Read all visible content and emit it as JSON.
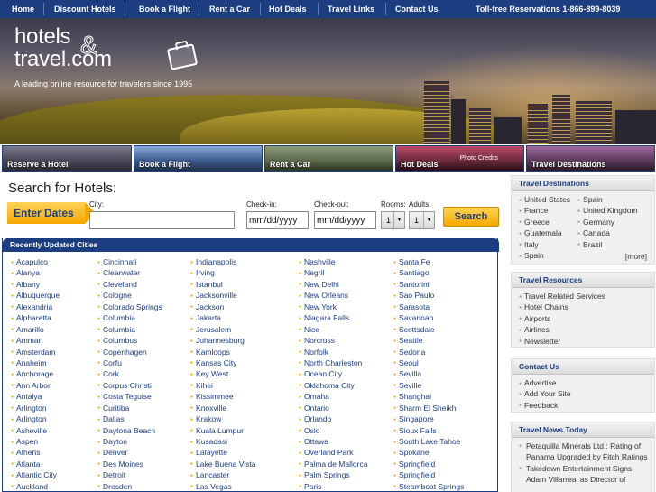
{
  "nav": {
    "items": [
      "Home",
      "Discount Hotels",
      "Book a Flight",
      "Rent a Car",
      "Hot Deals",
      "Travel Links",
      "Contact Us"
    ],
    "phone": "Toll-free Reservations 1-866-899-8039"
  },
  "banner": {
    "logo_line1": "hotels",
    "logo_amp": "&",
    "logo_line2": "travel.com",
    "tagline": "A leading online resource for travelers since 1995"
  },
  "tiles": {
    "items": [
      "Reserve a Hotel",
      "Book a Flight",
      "Rent a Car",
      "Hot Deals",
      "Travel Destinations"
    ],
    "photo_credits": "Photo Credits",
    "colors": [
      "#4a4a5c",
      "#3c5a8c",
      "#5c6a4c",
      "#6a2a3a",
      "#5a3a5a"
    ]
  },
  "search": {
    "title": "Search for Hotels:",
    "enter_dates": "Enter Dates",
    "city_label": "City:",
    "city_value": "",
    "checkin_label": "Check-in:",
    "checkin_value": "mm/dd/yyyy",
    "checkout_label": "Check-out:",
    "checkout_value": "mm/dd/yyyy",
    "rooms_label": "Rooms:",
    "rooms_value": "1",
    "adults_label": "Adults:",
    "adults_value": "1",
    "button": "Search"
  },
  "cities": {
    "header": "Recently Updated Cities",
    "columns": [
      [
        "Acapulco",
        "Alanya",
        "Albany",
        "Albuquerque",
        "Alexandria",
        "Alpharetta",
        "Amarillo",
        "Amman",
        "Amsterdam",
        "Anaheim",
        "Anchorage",
        "Ann Arbor",
        "Antalya",
        "Arlington",
        "Arlington",
        "Asheville",
        "Aspen",
        "Athens",
        "Atlanta",
        "Atlantic City",
        "Auckland"
      ],
      [
        "Cincinnati",
        "Clearwater",
        "Cleveland",
        "Cologne",
        "Colorado Springs",
        "Columbia",
        "Columbia",
        "Columbus",
        "Copenhagen",
        "Corfu",
        "Cork",
        "Corpus Christi",
        "Costa Teguise",
        "Curitiba",
        "Dallas",
        "Daytona Beach",
        "Dayton",
        "Denver",
        "Des Moines",
        "Detroit",
        "Dresden"
      ],
      [
        "Indianapolis",
        "Irving",
        "Istanbul",
        "Jacksonville",
        "Jackson",
        "Jakarta",
        "Jerusalem",
        "Johannesburg",
        "Kamloops",
        "Kansas City",
        "Key West",
        "Kihei",
        "Kissimmee",
        "Knoxville",
        "Krakow",
        "Kuala Lumpur",
        "Kusadasi",
        "Lafayette",
        "Lake Buena Vista",
        "Lancaster",
        "Las Vegas"
      ],
      [
        "Nashville",
        "Negril",
        "New Delhi",
        "New Orleans",
        "New York",
        "Niagara Falls",
        "Nice",
        "Norcross",
        "Norfolk",
        "North Charleston",
        "Ocean City",
        "Oklahoma City",
        "Omaha",
        "Ontario",
        "Orlando",
        "Oslo",
        "Ottawa",
        "Overland Park",
        "Palma de Mallorca",
        "Palm Springs",
        "Paris"
      ],
      [
        "Santa Fe",
        "Santiago",
        "Santorini",
        "Sao Paulo",
        "Sarasota",
        "Savannah",
        "Scottsdale",
        "Seattle",
        "Sedona",
        "Seoul",
        "Sevilla",
        "Seville",
        "Shanghai",
        "Sharm El Sheikh",
        "Singapore",
        "Sioux Falls",
        "South Lake Tahoe",
        "Spokane",
        "Springfield",
        "Springfield",
        "Steamboat Springs"
      ]
    ]
  },
  "sidebar": {
    "destinations": {
      "title": "Travel Destinations",
      "left": [
        "United States",
        "France",
        "Greece",
        "Guatemala",
        "Italy",
        "Spain"
      ],
      "right": [
        "Spain",
        "United Kingdom",
        "Germany",
        "Canada",
        "Brazil"
      ],
      "more": "[more]"
    },
    "resources": {
      "title": "Travel Resources",
      "items": [
        "Travel Related Services",
        "Hotel Chains",
        "Airports",
        "Airlines",
        "Newsletter"
      ]
    },
    "contact": {
      "title": "Contact Us",
      "items": [
        "Advertise",
        "Add Your Site",
        "Feedback"
      ]
    },
    "news": {
      "title": "Travel News Today",
      "items": [
        "Petaquilla Minerals Ltd.: Rating of Panama Upgraded by Fitch Ratings",
        "Takedown Entertainment Signs Adam Villarreal as Director of"
      ]
    }
  },
  "colors": {
    "brand_blue": "#1c3d7f",
    "accent_orange": "#f5a800"
  }
}
